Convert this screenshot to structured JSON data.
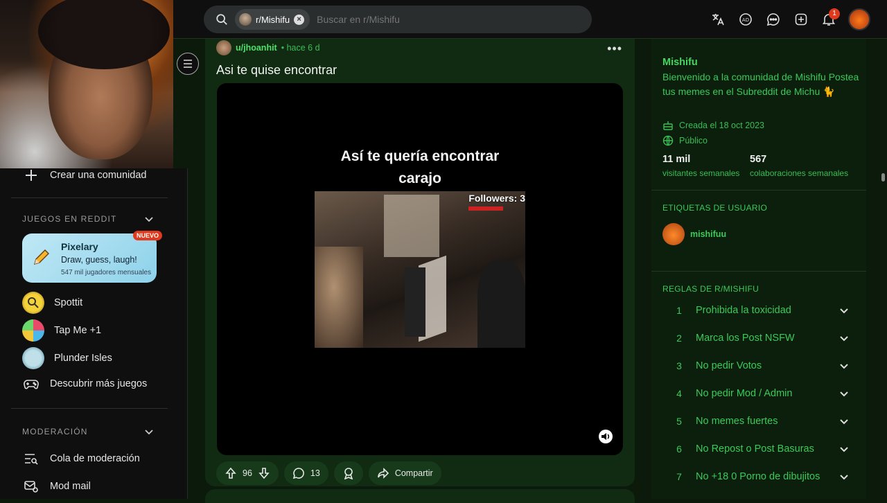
{
  "search": {
    "chip_label": "r/Mishifu",
    "placeholder": "Buscar en r/Mishifu"
  },
  "header": {
    "notif_count": "1"
  },
  "sidebar": {
    "create_community": "Crear una comunidad",
    "games_section": "JUEGOS EN REDDIT",
    "featured_game": {
      "title": "Pixelary",
      "subtitle": "Draw, guess, laugh!",
      "players": "547 mil jugadores mensuales",
      "badge": "NUEVO"
    },
    "games": [
      {
        "label": "Spottit"
      },
      {
        "label": "Tap Me +1"
      },
      {
        "label": "Plunder Isles"
      },
      {
        "label": "Descubrir más juegos"
      }
    ],
    "mod_section": "MODERACIÓN",
    "mod_items": [
      {
        "label": "Cola de moderación"
      },
      {
        "label": "Mod mail"
      }
    ]
  },
  "post": {
    "author": "u/jhoanhit",
    "time": "• hace 6 d",
    "title": "Asi te quise encontrar",
    "video_caption_line1": "Así te quería encontrar",
    "video_caption_line2": "carajo",
    "video_overlay": "Followers: 3",
    "votes": "96",
    "comments": "13",
    "share_label": "Compartir"
  },
  "community": {
    "name": "Mishifu",
    "description": "Bienvenido a la comunidad de Mishifu Postea tus memes en el Subreddit de Michu 🐈",
    "created": "Creada el 18 oct 2023",
    "visibility": "Público",
    "stats": [
      {
        "value": "11 mil",
        "label": "visitantes semanales"
      },
      {
        "value": "567",
        "label": "colaboraciones semanales"
      }
    ],
    "flair_section": "ETIQUETAS DE USUARIO",
    "flair_user": "mishifuu",
    "rules_section": "REGLAS DE R/MISHIFU",
    "rules": [
      {
        "num": "1",
        "text": "Prohibida la toxicidad"
      },
      {
        "num": "2",
        "text": "Marca los Post NSFW"
      },
      {
        "num": "3",
        "text": "No pedir Votos"
      },
      {
        "num": "4",
        "text": "No pedir Mod / Admin"
      },
      {
        "num": "5",
        "text": "No memes fuertes"
      },
      {
        "num": "6",
        "text": "No Repost o Post Basuras"
      },
      {
        "num": "7",
        "text": "No +18 0 Porno de dibujitos"
      }
    ]
  }
}
